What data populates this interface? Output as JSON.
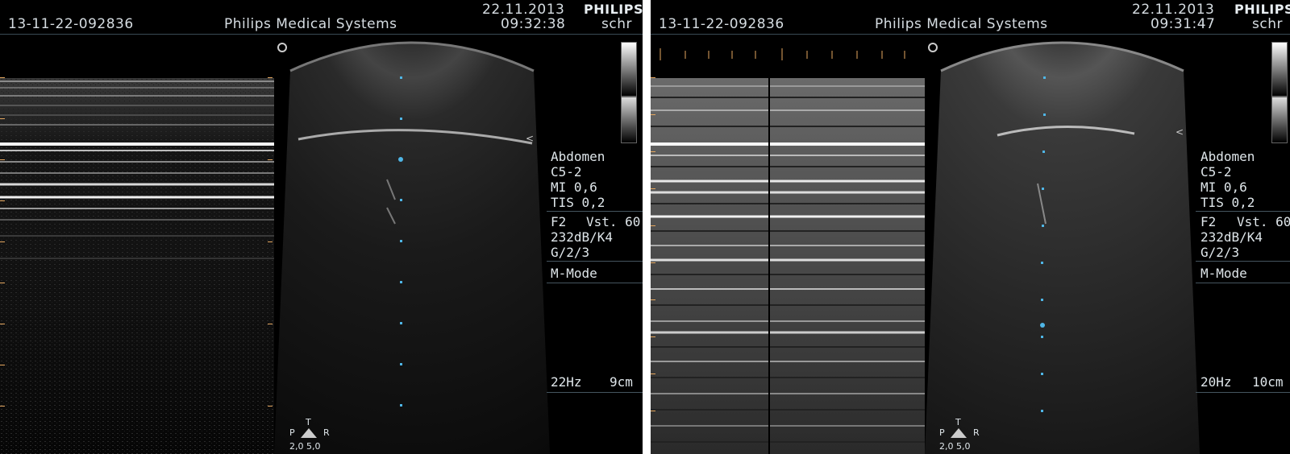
{
  "panels": [
    {
      "id": "13-11-22-092836",
      "company": "Philips Medical Systems",
      "date": "22.11.2013",
      "time": "09:32:38",
      "brand": "PHILIPS",
      "operator": "schr",
      "preset": "Abdomen",
      "probe": "C5-2",
      "mi": "MI 0,6",
      "tis": "TIS 0,2",
      "freq": "F2",
      "persistence": "Vst. 60",
      "dynamic_range": "232dB/K4",
      "gain": "G/2/3",
      "mode": "M-Mode",
      "frame_rate": "22Hz",
      "depth": "9cm",
      "orientation": {
        "top": "T",
        "left": "P",
        "right": "R",
        "values": "2,0 5,0"
      }
    },
    {
      "id": "13-11-22-092836",
      "company": "Philips Medical Systems",
      "date": "22.11.2013",
      "time": "09:31:47",
      "brand": "PHILIPS",
      "operator": "schr",
      "preset": "Abdomen",
      "probe": "C5-2",
      "mi": "MI 0,6",
      "tis": "TIS 0,2",
      "freq": "F2",
      "persistence": "Vst. 60",
      "dynamic_range": "232dB/K4",
      "gain": "G/2/3",
      "mode": "M-Mode",
      "frame_rate": "20Hz",
      "depth": "10cm",
      "orientation": {
        "top": "T",
        "left": "P",
        "right": "R",
        "values": "2,0 5,0"
      }
    }
  ],
  "colors": {
    "background": "#000000",
    "text": "#d6dde2",
    "cursor": "#4fb6e6",
    "tick": "#e6a860"
  }
}
